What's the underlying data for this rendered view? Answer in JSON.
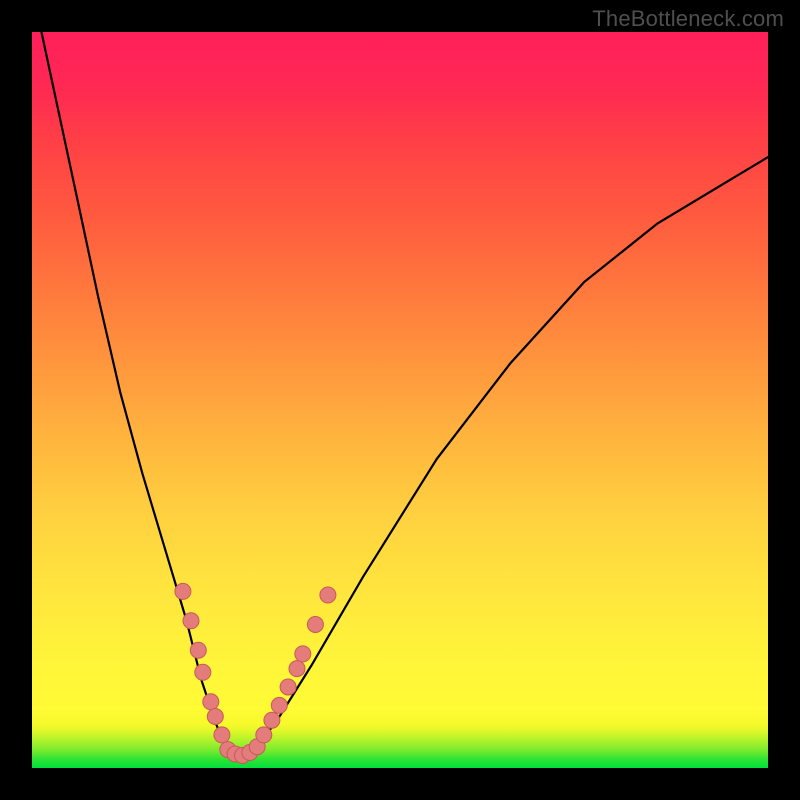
{
  "watermark": "TheBottleneck.com",
  "colors": {
    "frame": "#000000",
    "bead_fill": "#e47c7c",
    "bead_stroke": "#c55a5a",
    "curve": "#000000"
  },
  "chart_data": {
    "type": "line",
    "title": "",
    "xlabel": "",
    "ylabel": "",
    "xlim": [
      0,
      100
    ],
    "ylim": [
      0,
      100
    ],
    "series": [
      {
        "name": "bottleneck-curve",
        "x": [
          0,
          3,
          6,
          9,
          12,
          15,
          18,
          21,
          23,
          25,
          26.5,
          28,
          30,
          33,
          38,
          45,
          55,
          65,
          75,
          85,
          95,
          100
        ],
        "y": [
          106,
          92,
          78,
          64,
          51,
          40,
          30,
          20,
          12,
          6,
          2.5,
          1.5,
          2.5,
          6,
          14,
          26,
          42,
          55,
          66,
          74,
          80,
          83
        ]
      }
    ],
    "beads_left": [
      {
        "x": 20.5,
        "y": 24.0
      },
      {
        "x": 21.6,
        "y": 20.0
      },
      {
        "x": 22.6,
        "y": 16.0
      },
      {
        "x": 23.2,
        "y": 13.0
      },
      {
        "x": 24.3,
        "y": 9.0
      },
      {
        "x": 24.9,
        "y": 7.0
      },
      {
        "x": 25.8,
        "y": 4.5
      }
    ],
    "beads_bottom": [
      {
        "x": 26.6,
        "y": 2.5
      },
      {
        "x": 27.6,
        "y": 1.9
      },
      {
        "x": 28.6,
        "y": 1.7
      },
      {
        "x": 29.6,
        "y": 2.1
      },
      {
        "x": 30.6,
        "y": 2.9
      }
    ],
    "beads_right": [
      {
        "x": 31.5,
        "y": 4.5
      },
      {
        "x": 32.6,
        "y": 6.5
      },
      {
        "x": 33.6,
        "y": 8.5
      },
      {
        "x": 34.8,
        "y": 11.0
      },
      {
        "x": 36.0,
        "y": 13.5
      },
      {
        "x": 36.8,
        "y": 15.5
      },
      {
        "x": 38.5,
        "y": 19.5
      },
      {
        "x": 40.2,
        "y": 23.5
      }
    ]
  }
}
